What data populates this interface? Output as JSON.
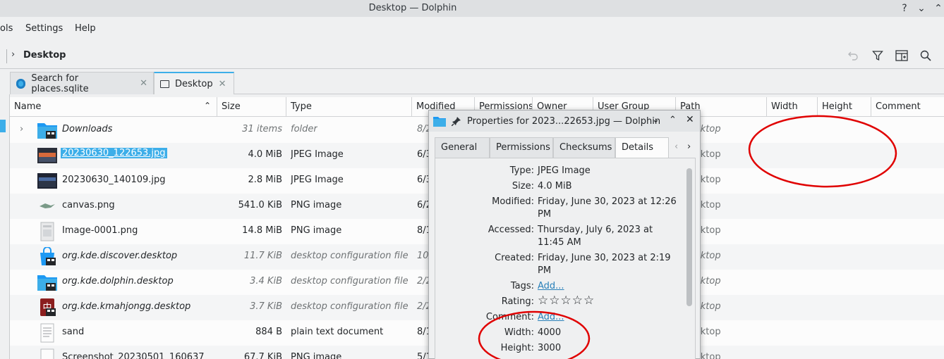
{
  "window": {
    "title": "Desktop — Dolphin",
    "buttons": [
      "?",
      "⌄",
      "⌃"
    ]
  },
  "menu": [
    "ols",
    "Settings",
    "Help"
  ],
  "breadcrumb": "Desktop",
  "tabs": [
    {
      "label": "Search for places.sqlite",
      "close": "✕"
    },
    {
      "label": "Desktop",
      "close": "✕"
    }
  ],
  "columns": {
    "name": "Name",
    "size": "Size",
    "type": "Type",
    "modified": "Modified",
    "permissions": "Permissions",
    "owner": "Owner",
    "group": "User Group",
    "path": "Path",
    "width": "Width",
    "height": "Height",
    "comment": "Comment"
  },
  "files": [
    {
      "name": "Downloads",
      "size": "31 items",
      "type": "folder",
      "mod": "8/2",
      "path": "sktop"
    },
    {
      "name": "20230630_122653.jpg",
      "size": "4.0 MiB",
      "type": "JPEG Image",
      "mod": "6/3",
      "path": "sktop"
    },
    {
      "name": "20230630_140109.jpg",
      "size": "2.8 MiB",
      "type": "JPEG Image",
      "mod": "6/3",
      "path": "sktop"
    },
    {
      "name": "canvas.png",
      "size": "541.0 KiB",
      "type": "PNG image",
      "mod": "6/2",
      "path": "sktop"
    },
    {
      "name": "Image-0001.png",
      "size": "14.8 MiB",
      "type": "PNG image",
      "mod": "8/1",
      "path": "sktop"
    },
    {
      "name": "org.kde.discover.desktop",
      "size": "11.7 KiB",
      "type": "desktop configuration file",
      "mod": "10/",
      "path": "sktop"
    },
    {
      "name": "org.kde.dolphin.desktop",
      "size": "3.4 KiB",
      "type": "desktop configuration file",
      "mod": "2/2",
      "path": "sktop"
    },
    {
      "name": "org.kde.kmahjongg.desktop",
      "size": "3.7 KiB",
      "type": "desktop configuration file",
      "mod": "2/2",
      "path": "sktop"
    },
    {
      "name": "sand",
      "size": "884 B",
      "type": "plain text document",
      "mod": "8/1",
      "path": "sktop"
    },
    {
      "name": "Screenshot_20230501_160637",
      "size": "67.7 KiB",
      "type": "PNG image",
      "mod": "5/1",
      "path": "sktop"
    }
  ],
  "dialog": {
    "title": "Properties for 2023...22653.jpg — Dolphin",
    "tabs": [
      "General",
      "Permissions",
      "Checksums",
      "Details"
    ],
    "props": {
      "type_label": "Type:",
      "type": "JPEG Image",
      "size_label": "Size:",
      "size": "4.0 MiB",
      "modified_label": "Modified:",
      "modified": "Friday, June 30, 2023 at 12:26 PM",
      "accessed_label": "Accessed:",
      "accessed": "Thursday, July 6, 2023 at 11:45 AM",
      "created_label": "Created:",
      "created": "Friday, June 30, 2023 at 2:19 PM",
      "tags_label": "Tags:",
      "tags": "Add...",
      "rating_label": "Rating:",
      "rating": "☆☆☆☆☆",
      "comment_label": "Comment:",
      "comment": "Add...",
      "width_label": "Width:",
      "width": "4000",
      "height_label": "Height:",
      "height": "3000"
    }
  },
  "colors": {
    "accent": "#3daee9",
    "annotation": "#e00000"
  }
}
